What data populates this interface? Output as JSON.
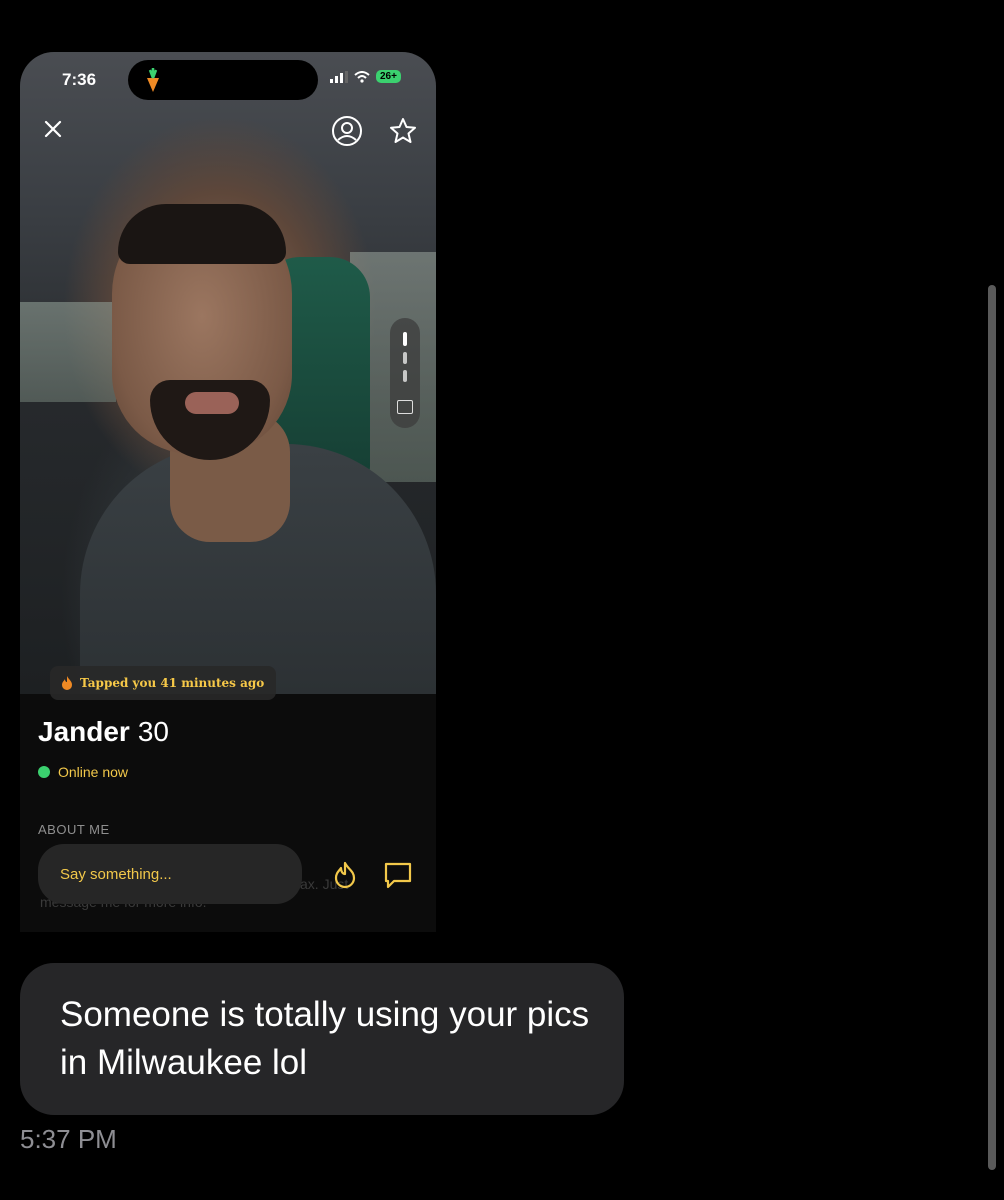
{
  "phone": {
    "status": {
      "time": "7:36",
      "battery": "26+"
    },
    "profile": {
      "tap_notice": "Tapped you 41 minutes ago",
      "name": "Jander",
      "age": "30",
      "online_status": "Online now",
      "about_label": "ABOUT ME",
      "partial_text_1": "message me for more info.",
      "partial_text_2": "ax. Just"
    },
    "compose": {
      "placeholder": "Say something..."
    }
  },
  "message": {
    "text": "Someone is totally using your pics in Milwaukee lol",
    "timestamp": "5:37 PM"
  },
  "colors": {
    "accent": "#f2c84a",
    "online": "#3bd16f",
    "bubble": "#262628",
    "background": "#000000"
  }
}
